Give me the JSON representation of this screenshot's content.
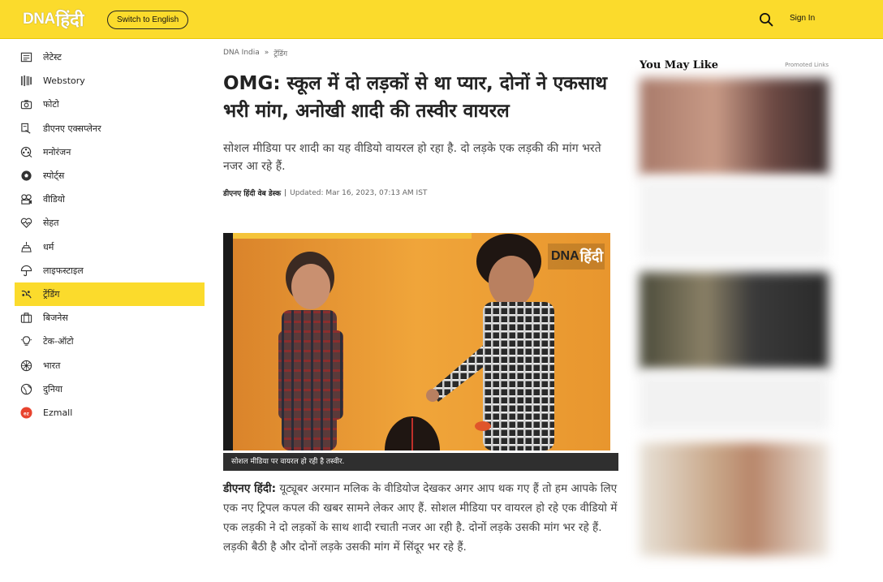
{
  "header": {
    "logo_dna": "DNA",
    "logo_hindi": "हिंदी",
    "switch_label": "Switch to English",
    "search_icon": "search-icon",
    "signin_label": "Sign In"
  },
  "sidebar": {
    "items": [
      {
        "label": "लेटेस्ट",
        "icon": "newspaper-icon"
      },
      {
        "label": "Webstory",
        "icon": "webstory-icon"
      },
      {
        "label": "फोटो",
        "icon": "camera-icon"
      },
      {
        "label": "डीएनए एक्सप्लेनर",
        "icon": "explainer-icon"
      },
      {
        "label": "मनोरंजन",
        "icon": "film-reel-icon"
      },
      {
        "label": "स्पोर्ट्स",
        "icon": "football-icon"
      },
      {
        "label": "वीडियो",
        "icon": "video-icon"
      },
      {
        "label": "सेहत",
        "icon": "heart-pulse-icon"
      },
      {
        "label": "धर्म",
        "icon": "religion-icon"
      },
      {
        "label": "लाइफस्टाइल",
        "icon": "umbrella-icon"
      },
      {
        "label": "ट्रेंडिंग",
        "icon": "trending-icon"
      },
      {
        "label": "बिजनेस",
        "icon": "briefcase-icon"
      },
      {
        "label": "टेक-ऑटो",
        "icon": "lightbulb-icon"
      },
      {
        "label": "भारत",
        "icon": "chakra-icon"
      },
      {
        "label": "दुनिया",
        "icon": "globe-icon"
      },
      {
        "label": "Ezmall",
        "icon": "ezmall-icon"
      }
    ],
    "active_index": 10
  },
  "article": {
    "breadcrumb": [
      "DNA India",
      "ट्रेंडिंग"
    ],
    "breadcrumb_sep": "»",
    "headline": "OMG: स्कूल में दो लड़कों से था प्यार, दोनों ने एकसाथ भरी मांग, अनोखी शादी की तस्वीर वायरल",
    "summary": "सोशल मीडिया पर शादी का यह वीडियो वायरल हो रहा है. दो लड़के एक लड़की की मांग भरते नजर आ रहे हैं.",
    "author": "डीएनए हिंदी वेब डेस्क",
    "byline_sep": "|",
    "updated": "Updated: Mar 16, 2023, 07:13 AM IST",
    "image_watermark_dna": "DNA",
    "image_watermark_hindi": "हिंदी",
    "caption": "सोशल मीडिया पर वायरल हो रही है तस्वीर.",
    "body_lead": "डीएनए हिंदी:",
    "body_text": " यूट्यूबर अरमान मलिक के वीडियोज देखकर अगर आप थक गए हैं तो हम आपके लिए एक नए ट्रिपल कपल की खबर सामने लेकर आए हैं. सोशल मीडिया पर वायरल हो रहे एक वीडियो में एक लड़की ने दो लड़कों के साथ शादी रचाती नजर आ रही है. दोनों लड़के उसकी मांग भर रहे हैं. लड़की बैठी है और दोनों लड़के उसकी मांग में सिंदूर भर रहे हैं."
  },
  "rail": {
    "title": "You May Like",
    "promoted": "Promoted Links"
  },
  "colors": {
    "brand_yellow": "#fbdb2c",
    "caption_bg": "#2f2f2f",
    "image_orange": "#e8982c"
  }
}
